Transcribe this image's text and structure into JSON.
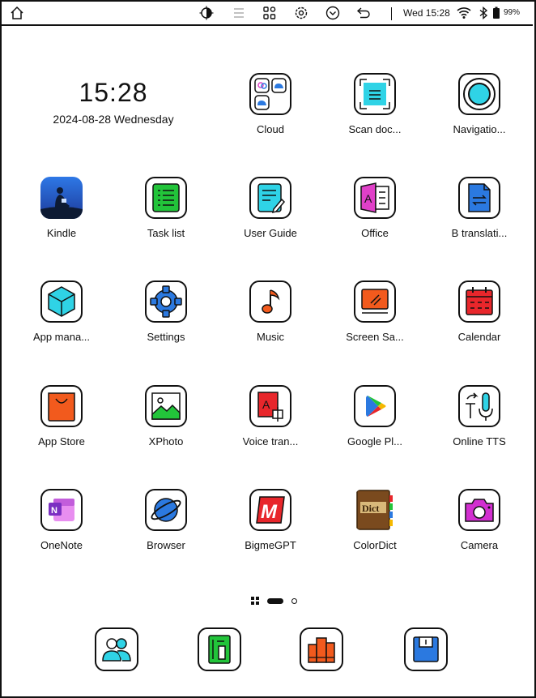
{
  "statusbar": {
    "time": "Wed 15:28",
    "battery": "99%",
    "icons": [
      "home-icon",
      "eink-refresh-icon",
      "menu-list-icon",
      "apps-grid-icon",
      "settings-icon",
      "chevron-down-circle-icon",
      "back-icon",
      "wifi-icon",
      "bluetooth-icon",
      "battery-icon"
    ]
  },
  "clock": {
    "time": "15:28",
    "date": "2024-08-28 Wednesday"
  },
  "apps": [
    {
      "label": "Cloud",
      "icon": "cloud-folder-icon"
    },
    {
      "label": "Scan doc...",
      "icon": "scan-document-icon"
    },
    {
      "label": "Navigatio...",
      "icon": "navigation-ball-icon"
    },
    {
      "label": "Kindle",
      "icon": "kindle-icon"
    },
    {
      "label": "Task list",
      "icon": "task-list-icon"
    },
    {
      "label": "User Guide",
      "icon": "user-guide-icon"
    },
    {
      "label": "Office",
      "icon": "office-icon"
    },
    {
      "label": "B translati...",
      "icon": "translation-icon"
    },
    {
      "label": "App mana...",
      "icon": "app-manager-icon"
    },
    {
      "label": "Settings",
      "icon": "settings-gear-icon"
    },
    {
      "label": "Music",
      "icon": "music-note-icon"
    },
    {
      "label": "Screen Sa...",
      "icon": "screen-saver-icon"
    },
    {
      "label": "Calendar",
      "icon": "calendar-icon"
    },
    {
      "label": "App Store",
      "icon": "app-store-bag-icon"
    },
    {
      "label": "XPhoto",
      "icon": "photo-icon"
    },
    {
      "label": "Voice tran...",
      "icon": "voice-translate-icon"
    },
    {
      "label": "Google Pl...",
      "icon": "google-play-icon"
    },
    {
      "label": "Online TTS",
      "icon": "tts-icon"
    },
    {
      "label": "OneNote",
      "icon": "onenote-icon"
    },
    {
      "label": "Browser",
      "icon": "browser-planet-icon"
    },
    {
      "label": "BigmeGPT",
      "icon": "bigmegpt-icon"
    },
    {
      "label": "ColorDict",
      "icon": "colordict-icon"
    },
    {
      "label": "Camera",
      "icon": "camera-icon"
    }
  ],
  "dock": [
    {
      "icon": "contacts-icon"
    },
    {
      "icon": "notes-icon"
    },
    {
      "icon": "library-books-icon"
    },
    {
      "icon": "storage-icon"
    }
  ],
  "page_indicator": {
    "pages": 2,
    "current": 1
  },
  "colors": {
    "cyan": "#2fd3e6",
    "green": "#22c43a",
    "red": "#e8262b",
    "orange": "#f25a1d",
    "blue": "#2b79e0",
    "pink": "#e040c8",
    "magenta": "#d22fd0"
  }
}
